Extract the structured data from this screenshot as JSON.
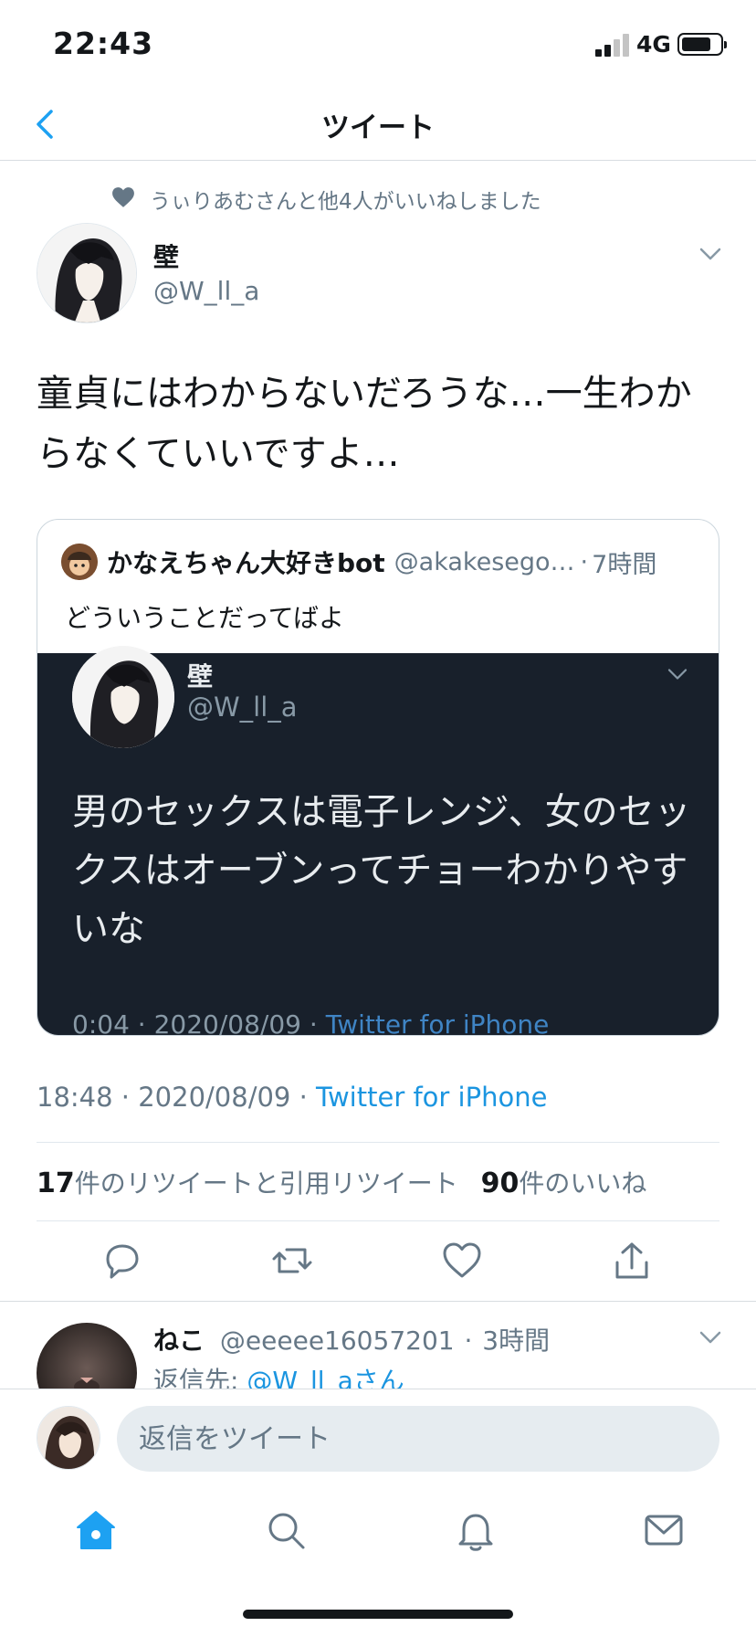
{
  "status_bar": {
    "time": "22:43",
    "network": "4G"
  },
  "nav": {
    "title": "ツイート"
  },
  "social_context": {
    "text": "うぃりあむさんと他4人がいいねしました"
  },
  "tweet": {
    "author_name": "壁",
    "author_handle": "@W_ll_a",
    "text": "童貞にはわからないだろうな…一生わからなくていいですよ…",
    "time": "18:48",
    "date": "2020/08/09",
    "source": "Twitter for iPhone",
    "retweet_count": "17",
    "retweet_label": "件のリツイートと引用リツイート",
    "like_count": "90",
    "like_label": "件のいいね"
  },
  "quoted_tweet": {
    "author_name": "かなえちゃん大好きbot",
    "author_handle": "@akakesego…",
    "time_ago": "7時間",
    "text": "どういうことだってばよ",
    "image": {
      "author_name": "壁",
      "author_handle": "@W_ll_a",
      "text": "男のセックスは電子レンジ、女のセックスはオーブンってチョーわかりやすいな",
      "meta_time": "0:04",
      "meta_date": "2020/08/09",
      "meta_source": "Twitter for iPhone"
    }
  },
  "reply": {
    "name": "ねこ",
    "handle": "@eeeee16057201",
    "time_ago": "3時間",
    "reply_to_label": "返信先:",
    "reply_to_user": "@W_ll_aさん"
  },
  "compose": {
    "placeholder": "返信をツイート"
  },
  "separator": "·",
  "colors": {
    "accent": "#1da1f2",
    "dark_bg": "#18202b",
    "muted": "#657786"
  }
}
